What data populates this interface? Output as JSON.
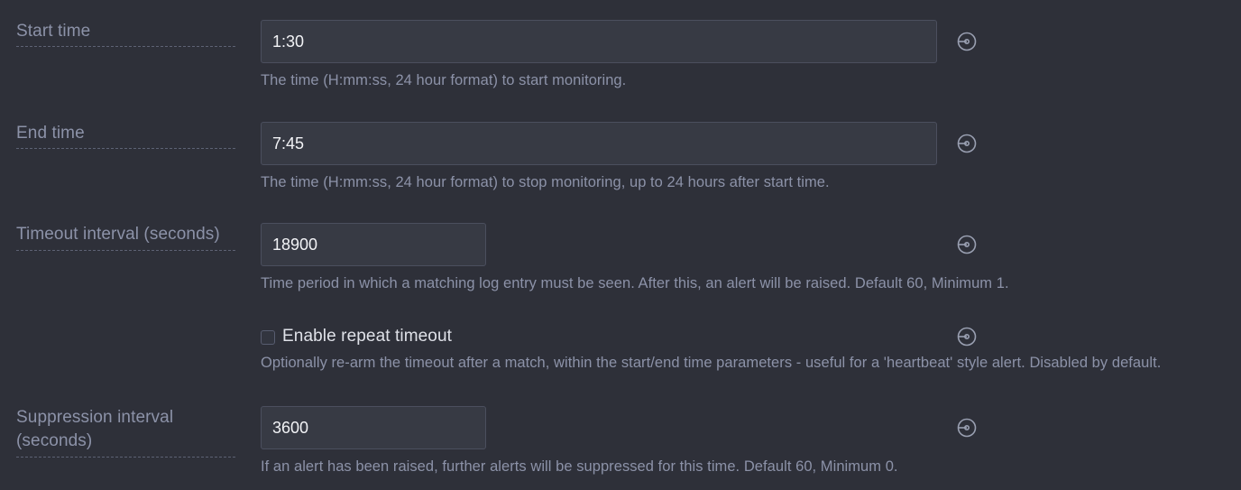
{
  "theme": {
    "page_background": "#2e3039",
    "input_background": "#373a44",
    "input_border": "#4b4f5e",
    "label_color": "#8c92a8",
    "help_text_color": "#8c92a8",
    "value_color": "#f2f3f6",
    "icon_color": "#9aa0b2"
  },
  "fields": [
    {
      "id": "start-time",
      "label": "Start time",
      "value": "1:30",
      "placeholder": "",
      "help": "The time (H:mm:ss, 24 hour format) to start monitoring.",
      "icon": "target-info-icon"
    },
    {
      "id": "end-time",
      "label": "End time",
      "value": "7:45",
      "placeholder": "",
      "help": "The time (H:mm:ss, 24 hour format) to stop monitoring, up to 24 hours after start time.",
      "icon": "target-info-icon"
    },
    {
      "id": "timeout-interval",
      "label": "Timeout interval (seconds)",
      "value": "18900",
      "placeholder": "",
      "help": "Time period in which a matching log entry must be seen. After this, an alert will be raised. Default 60, Minimum 1.",
      "icon": "target-info-icon"
    },
    {
      "id": "enable-repeat-timeout",
      "label": "",
      "checkbox_label": "Enable repeat timeout",
      "checked": false,
      "help": "Optionally re-arm the timeout after a match, within the start/end time parameters - useful for a 'heartbeat' style alert. Disabled by default.",
      "icon": "target-info-icon"
    },
    {
      "id": "suppression-interval",
      "label": "Suppression interval (seconds)",
      "value": "3600",
      "placeholder": "",
      "help": "If an alert has been raised, further alerts will be suppressed for this time. Default 60, Minimum 0.",
      "icon": "target-info-icon"
    }
  ]
}
